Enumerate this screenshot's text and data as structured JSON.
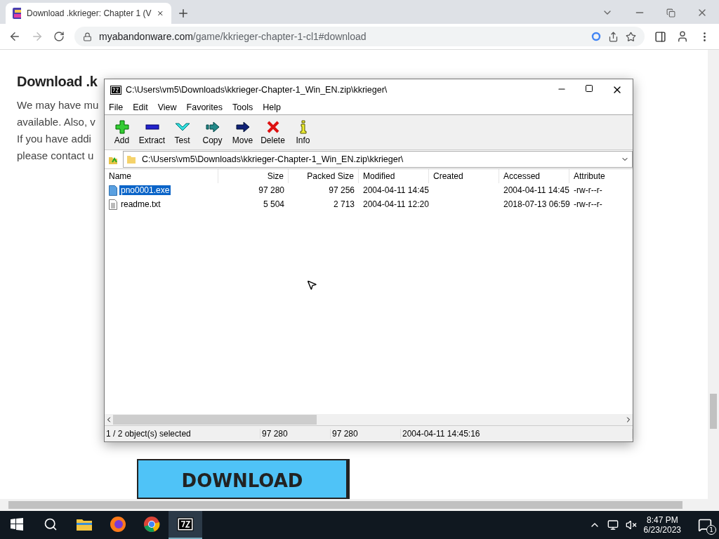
{
  "browser": {
    "tab": {
      "title": "Download .kkrieger: Chapter 1 (V"
    },
    "url": {
      "host": "myabandonware.com",
      "path": "/game/kkrieger-chapter-1-cl1#download"
    }
  },
  "page": {
    "heading": "Download .k",
    "paragraph_lines": [
      "We may have mu",
      "available. Also, v",
      "If you have addi",
      "please contact u"
    ],
    "download_button": "DOWNLOAD"
  },
  "archive_window": {
    "title": "C:\\Users\\vm5\\Downloads\\kkrieger-Chapter-1_Win_EN.zip\\kkrieger\\",
    "menu": [
      "File",
      "Edit",
      "View",
      "Favorites",
      "Tools",
      "Help"
    ],
    "toolbar": [
      {
        "label": "Add",
        "kind": "add"
      },
      {
        "label": "Extract",
        "kind": "extract"
      },
      {
        "label": "Test",
        "kind": "test"
      },
      {
        "label": "Copy",
        "kind": "copy"
      },
      {
        "label": "Move",
        "kind": "move"
      },
      {
        "label": "Delete",
        "kind": "delete"
      },
      {
        "label": "Info",
        "kind": "info"
      }
    ],
    "path": "C:\\Users\\vm5\\Downloads\\kkrieger-Chapter-1_Win_EN.zip\\kkrieger\\",
    "columns": [
      "Name",
      "Size",
      "Packed Size",
      "Modified",
      "Created",
      "Accessed",
      "Attribute"
    ],
    "rows": [
      {
        "kind": "exe",
        "selected": true,
        "cells": [
          "pno0001.exe",
          "97 280",
          "97 256",
          "2004-04-11 14:45",
          "",
          "2004-04-11 14:45",
          "-rw-r--r-"
        ]
      },
      {
        "kind": "text",
        "selected": false,
        "cells": [
          "readme.txt",
          "5 504",
          "2 713",
          "2004-04-11 12:20",
          "",
          "2018-07-13 06:59",
          "-rw-r--r-"
        ]
      }
    ],
    "status": [
      "1 / 2 object(s) selected",
      "97 280",
      "97 280",
      "2004-04-11 14:45:16"
    ]
  },
  "taskbar": {
    "apps": [
      {
        "kind": "explorer",
        "active": false
      },
      {
        "kind": "firefox",
        "active": false
      },
      {
        "kind": "chrome",
        "active": false
      },
      {
        "kind": "sevenzip",
        "active": true
      }
    ],
    "time": "8:47 PM",
    "date": "6/23/2023",
    "notifications": "1"
  }
}
